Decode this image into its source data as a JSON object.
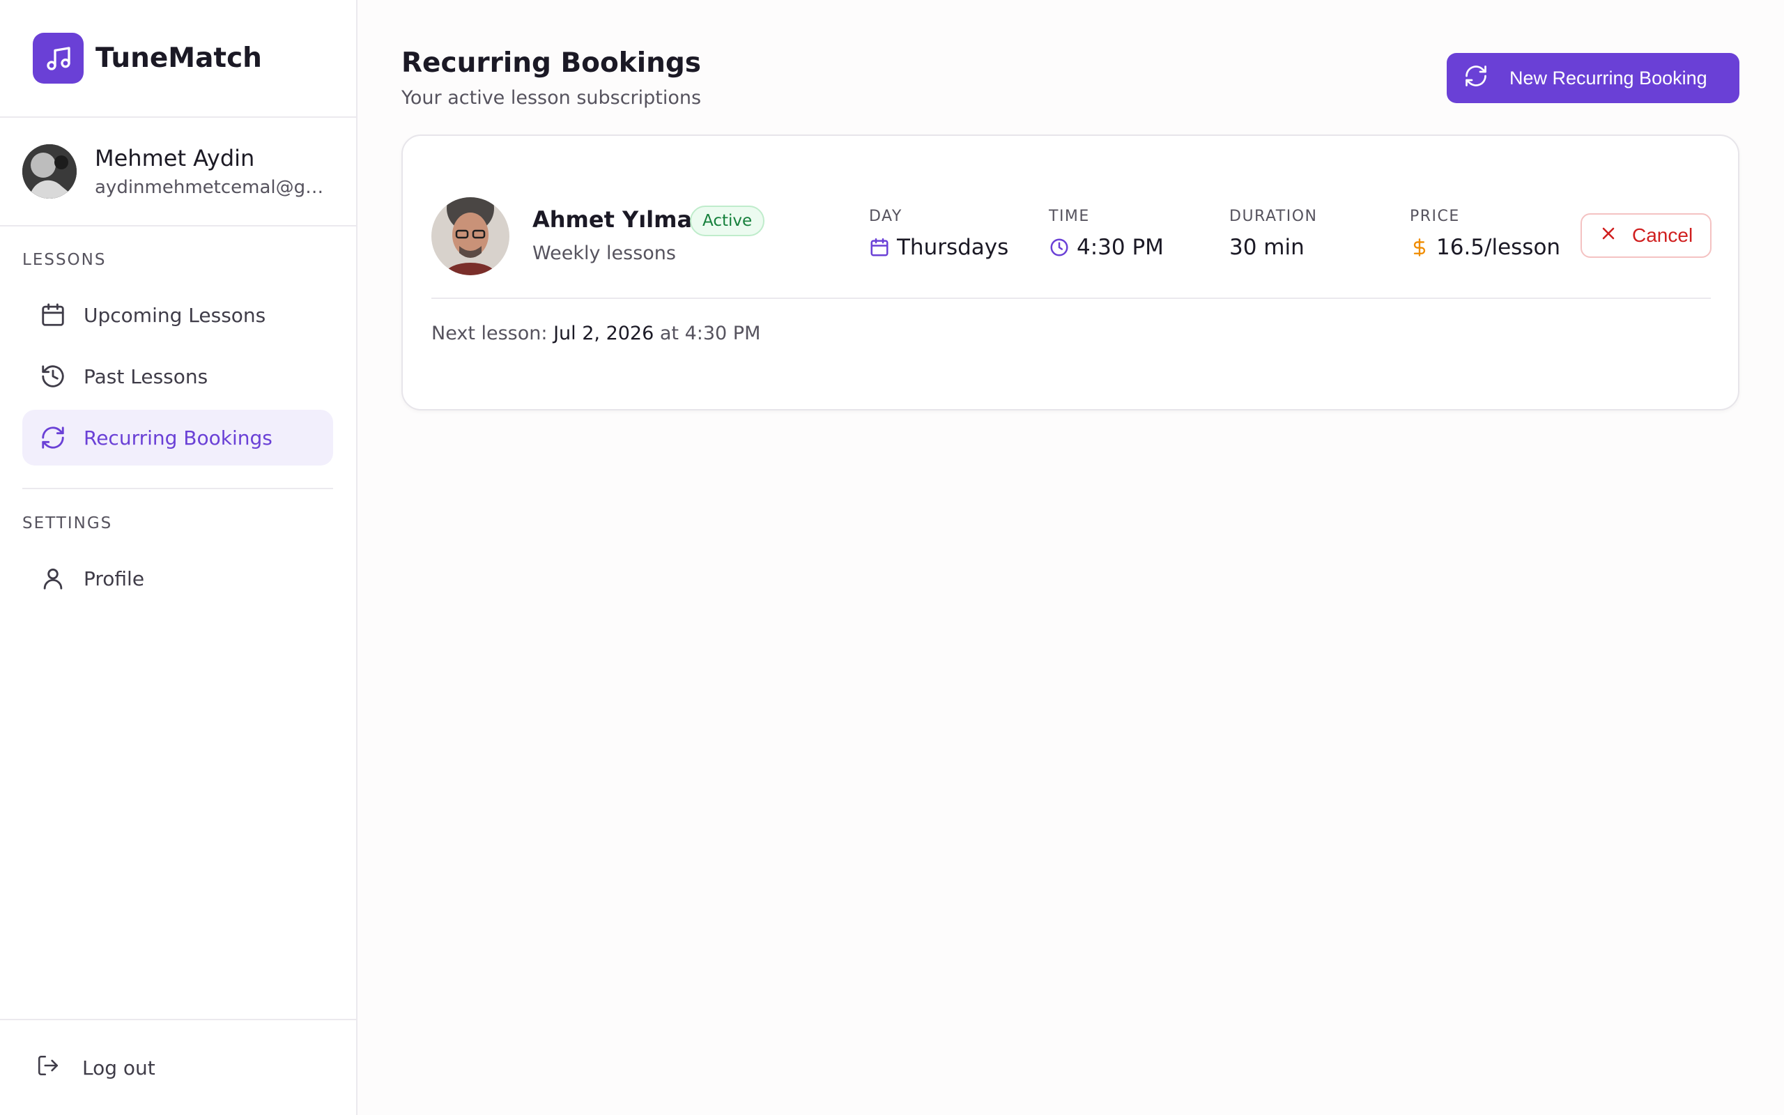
{
  "brand": {
    "name": "TuneMatch",
    "logo_icon": "music-note-icon",
    "accent": "#6a40d6"
  },
  "user": {
    "name": "Mehmet Aydin",
    "email": "aydinmehmetcemal@gm..."
  },
  "sidebar": {
    "lessons_label": "LESSONS",
    "items": [
      {
        "label": "Upcoming Lessons",
        "icon": "calendar-icon"
      },
      {
        "label": "Past Lessons",
        "icon": "history-icon"
      },
      {
        "label": "Recurring Bookings",
        "icon": "refresh-icon",
        "active": true
      }
    ],
    "settings_label": "SETTINGS",
    "settings_items": [
      {
        "label": "Profile",
        "icon": "user-icon"
      }
    ],
    "logout_label": "Log out"
  },
  "main": {
    "title": "Recurring Bookings",
    "subtitle": "Your active lesson subscriptions",
    "new_button_label": "New Recurring Booking"
  },
  "booking": {
    "teacher_name": "Ahmet Yılmaz",
    "status": "Active",
    "frequency": "Weekly lessons",
    "day_label": "DAY",
    "day_value": "Thursdays",
    "time_label": "TIME",
    "time_value": "4:30 PM",
    "duration_label": "DURATION",
    "duration_value": "30 min",
    "price_label": "PRICE",
    "price_value": "16.5/lesson",
    "cancel_label": "Cancel",
    "next_prefix": "Next lesson:",
    "next_date": "Jul 2, 2026",
    "next_at": "at 4:30 PM"
  }
}
